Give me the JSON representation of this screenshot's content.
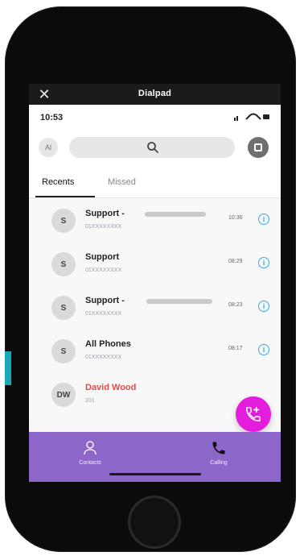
{
  "window": {
    "title": "Dialpad",
    "close_glyph": "✕"
  },
  "status": {
    "time": "10:53"
  },
  "search": {
    "avatar_text": "Al",
    "placeholder": "",
    "icon": "search-icon",
    "dialpad_icon": "dialpad-icon"
  },
  "tabs": [
    {
      "label": "Recents",
      "active": true
    },
    {
      "label": "Missed",
      "active": false
    }
  ],
  "calls": [
    {
      "avatar": "S",
      "name": "Support - ",
      "number": "01XXXXXXXX",
      "time": "10:36",
      "missed": false
    },
    {
      "avatar": "S",
      "name": "Support",
      "number": "01XXXXXXXX",
      "time": "08:29",
      "missed": false
    },
    {
      "avatar": "S",
      "name": "Support - ",
      "number": "01XXXXXXXX",
      "time": "08:23",
      "missed": false
    },
    {
      "avatar": "S",
      "name": "All Phones",
      "number": "01XXXXXXXX",
      "time": "08:17",
      "missed": false
    },
    {
      "avatar": "DW",
      "name": "David Wood",
      "number": "201",
      "time": "",
      "missed": true
    }
  ],
  "bottom_nav": {
    "contacts_label": "Contacts",
    "calling_label": "Calling"
  },
  "colors": {
    "accent_purple": "#8d66c9",
    "fab_pink": "#e31ddb",
    "missed_red": "#e24b4b",
    "info_blue": "#3aa7e6"
  }
}
